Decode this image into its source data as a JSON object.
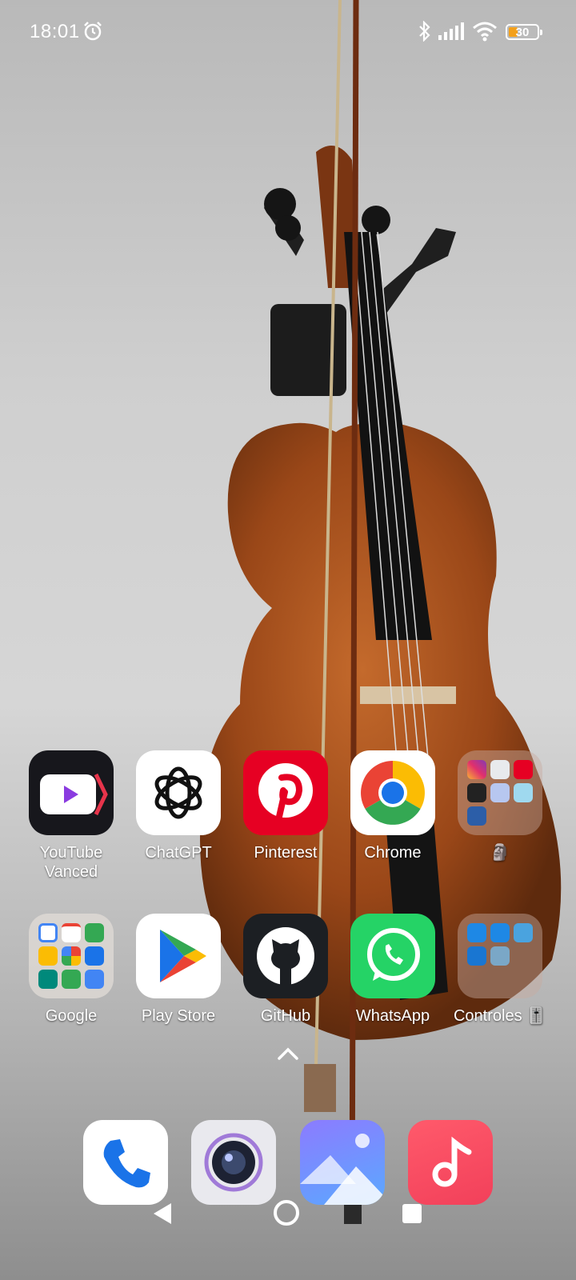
{
  "status_bar": {
    "time": "18:01",
    "battery_level": "30",
    "icons": [
      "alarm-icon",
      "bluetooth-icon",
      "signal-icon",
      "wifi-icon",
      "battery-icon"
    ]
  },
  "home": {
    "row1": [
      {
        "label": "YouTube\nVanced",
        "icon": "youtube-vanced-icon"
      },
      {
        "label": "ChatGPT",
        "icon": "chatgpt-icon"
      },
      {
        "label": "Pinterest",
        "icon": "pinterest-icon"
      },
      {
        "label": "Chrome",
        "icon": "chrome-icon"
      },
      {
        "label": "🗿",
        "icon": "folder-icon"
      }
    ],
    "row2": [
      {
        "label": "Google",
        "icon": "google-folder-icon"
      },
      {
        "label": "Play Store",
        "icon": "play-store-icon"
      },
      {
        "label": "GitHub",
        "icon": "github-icon"
      },
      {
        "label": "WhatsApp",
        "icon": "whatsapp-icon"
      },
      {
        "label": "Controles 🎚️",
        "icon": "controls-folder-icon"
      }
    ]
  },
  "dock": [
    "phone-icon",
    "camera-icon",
    "gallery-icon",
    "music-icon"
  ],
  "nav_bar": [
    "back-icon",
    "home-icon",
    "recents-icon"
  ],
  "colors": {
    "pinterest": "#e60023",
    "whatsapp": "#25d366",
    "chrome_blue": "#1a73e8",
    "music": "#f2405a"
  }
}
